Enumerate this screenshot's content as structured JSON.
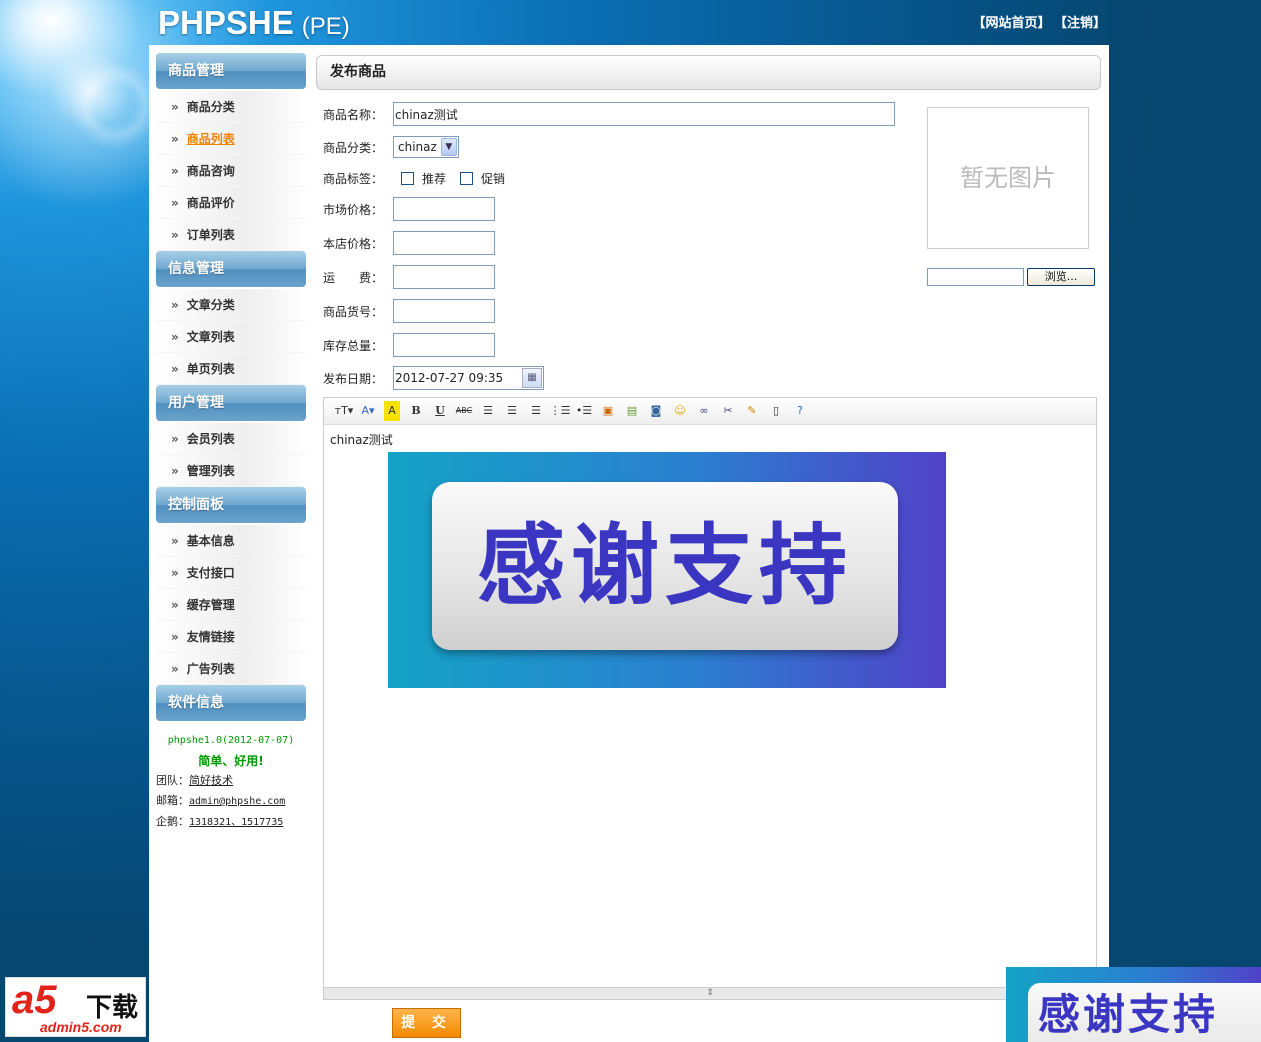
{
  "header": {
    "logo": "PHPSHE",
    "logo_suffix": "(PE)",
    "links": [
      "【网站首页】",
      "【注销】"
    ]
  },
  "sidebar": {
    "sections": [
      {
        "title": "商品管理",
        "items": [
          "商品分类",
          "商品列表",
          "商品咨询",
          "商品评价",
          "订单列表"
        ]
      },
      {
        "title": "信息管理",
        "items": [
          "文章分类",
          "文章列表",
          "单页列表"
        ]
      },
      {
        "title": "用户管理",
        "items": [
          "会员列表",
          "管理列表"
        ]
      },
      {
        "title": "控制面板",
        "items": [
          "基本信息",
          "支付接口",
          "缓存管理",
          "友情链接",
          "广告列表"
        ]
      },
      {
        "title": "软件信息",
        "items": []
      }
    ],
    "active_item": "商品列表",
    "arrow": "»",
    "software": {
      "version": "phpshe1.0(2012-07-07)",
      "slogan": "简单、好用!",
      "team_label": "团队：",
      "team": "简好技术",
      "email_label": "邮箱：",
      "email": "admin@phpshe.com",
      "qq_label": "企鹅：",
      "qq": "1318321、1517735"
    }
  },
  "main": {
    "title": "发布商品",
    "form": {
      "name_label": "商品名称：",
      "name_value": "chinaz测试",
      "category_label": "商品分类：",
      "category_value": "chinaz",
      "tag_label": "商品标签：",
      "tag_recommend": "推荐",
      "tag_promo": "促销",
      "market_price_label": "市场价格：",
      "shop_price_label": "本店价格：",
      "shipping_label": "运　　费：",
      "sku_label": "商品货号：",
      "stock_label": "库存总量：",
      "date_label": "发布日期：",
      "date_value": "2012-07-27 09:35"
    },
    "image_placeholder": "暂无图片",
    "browse_label": "浏览...",
    "editor": {
      "content_text": "chinaz测试",
      "image_text": "感谢支持"
    },
    "submit_label": "提 交"
  },
  "watermarks": {
    "a5_big": "a5",
    "a5_download": "下载",
    "a5_domain": "admin5.com",
    "corner_text": "感谢支持"
  }
}
